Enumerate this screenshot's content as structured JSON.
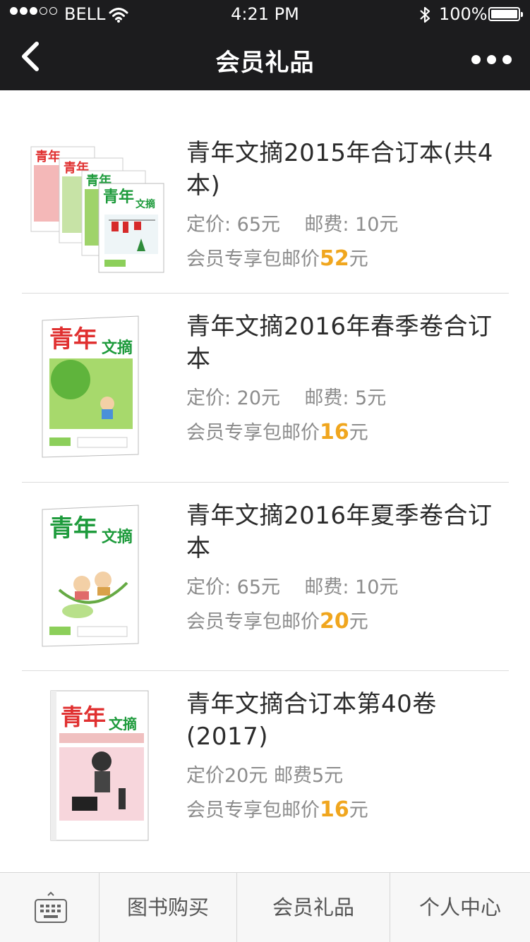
{
  "status_bar": {
    "carrier": "BELL",
    "time": "4:21 PM",
    "battery": "100%"
  },
  "nav": {
    "title": "会员礼品",
    "back_icon": "chevron-left-icon",
    "more_icon": "more-dots-icon"
  },
  "products": [
    {
      "title": "青年文摘2015年合订本(共4本)",
      "meta": "定价: 65元    邮费: 10元",
      "member_label": "会员专享包邮价",
      "member_price": "52",
      "currency": "元",
      "cover_theme": "four-book-set"
    },
    {
      "title": "青年文摘2016年春季卷合订本",
      "meta": "定价: 20元    邮费: 5元",
      "member_label": "会员专享包邮价",
      "member_price": "16",
      "currency": "元",
      "cover_theme": "spring-green"
    },
    {
      "title": "青年文摘2016年夏季卷合订本",
      "meta": "定价: 65元    邮费: 10元",
      "member_label": "会员专享包邮价",
      "member_price": "20",
      "currency": "元",
      "cover_theme": "summer-hammock"
    },
    {
      "title": "青年文摘合订本第40卷(2017)",
      "meta": "定价20元 邮费5元",
      "member_label": "会员专享包邮价",
      "member_price": "16",
      "currency": "元",
      "cover_theme": "pink-concert"
    }
  ],
  "tabbar": {
    "keyboard_icon": "keyboard-icon",
    "tabs": [
      {
        "label": "图书购买"
      },
      {
        "label": "会员礼品"
      },
      {
        "label": "个人中心"
      }
    ]
  },
  "colors": {
    "bar": "#1c1c1e",
    "price_accent": "#f0a61e",
    "brand_green": "#1e9b3c",
    "brand_red": "#e03030"
  }
}
